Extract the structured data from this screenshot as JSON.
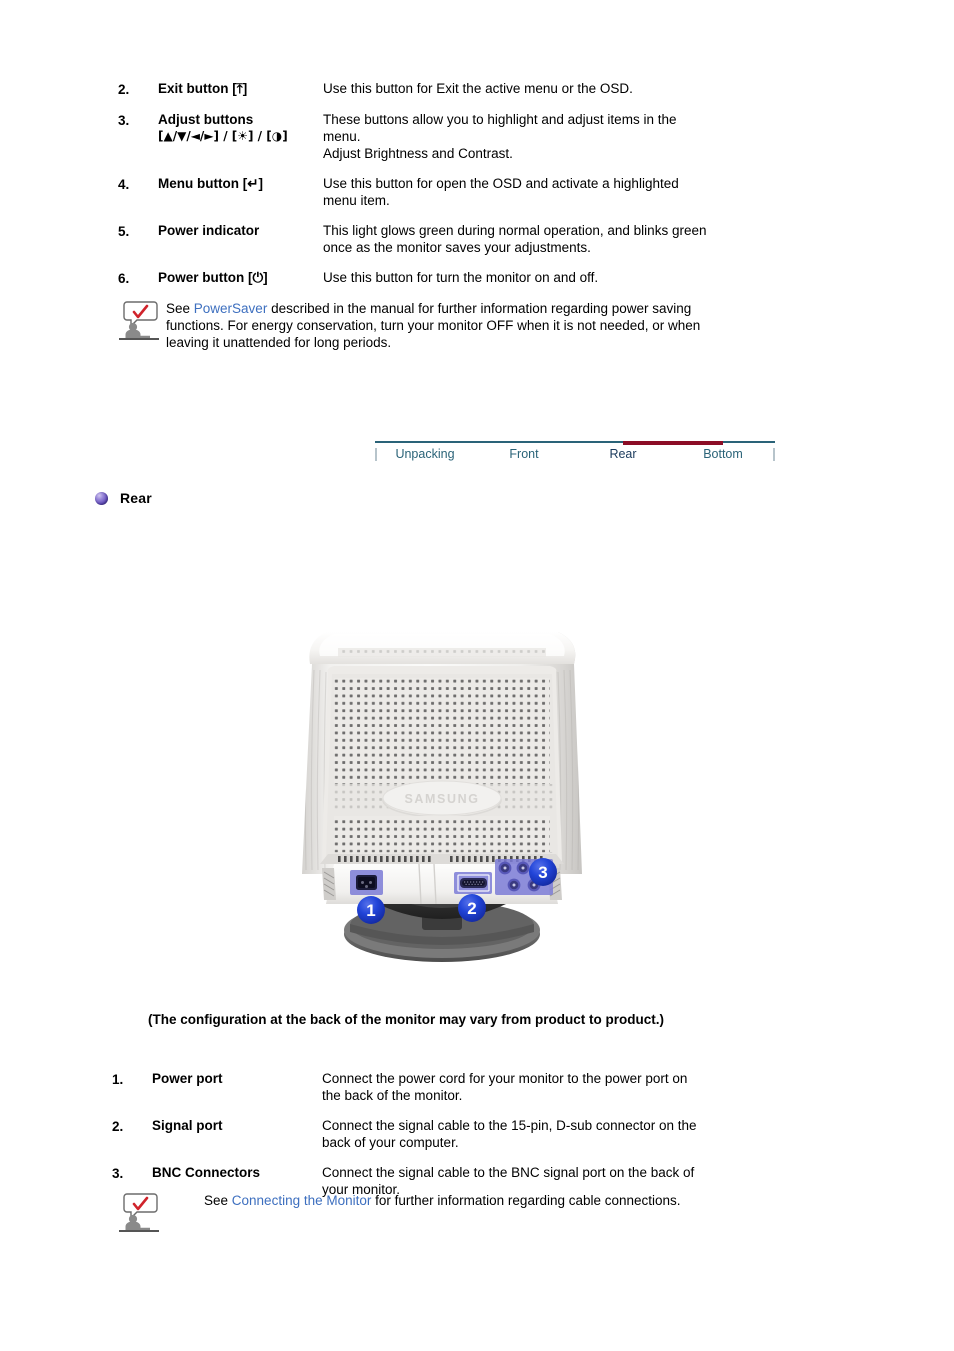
{
  "front_controls": {
    "items": [
      {
        "num": "2.",
        "term": "Exit button [",
        "term_glyph": "⇥⬆",
        "term_tail": "]",
        "term_lines": [
          "Exit button [⤒]"
        ],
        "desc": [
          "Use this button for Exit the active menu or the OSD."
        ]
      },
      {
        "num": "3.",
        "term_lines": [
          "Adjust buttons",
          "[▲/▼/◄/►] / [☀] / [◑]"
        ],
        "desc": [
          "These buttons allow you to highlight and adjust items in the",
          "menu.",
          "Adjust Brightness and Contrast."
        ]
      },
      {
        "num": "4.",
        "term_lines": [
          "Menu button [↵]"
        ],
        "desc": [
          "Use this button for open the OSD and activate a highlighted",
          "menu item."
        ]
      },
      {
        "num": "5.",
        "term_lines": [
          "Power indicator"
        ],
        "desc": [
          "This light glows green during normal operation, and blinks green",
          "once as the monitor saves your adjustments."
        ]
      },
      {
        "num": "6.",
        "term_lines": [
          "Power button [⏻]"
        ],
        "desc": [
          "Use this button for turn the monitor on and off."
        ]
      }
    ]
  },
  "note_powersaver": {
    "icon": "note-person-checkmark-icon",
    "lead": "See ",
    "link": "PowerSaver",
    "lines": [
      " described in the manual for further information regarding power saving",
      "functions. For energy conservation, turn your monitor OFF when it is not needed, or when",
      "leaving it unattended for long periods."
    ]
  },
  "tabbar": {
    "tabs": [
      {
        "label": "Unpacking",
        "active": false
      },
      {
        "label": "Front",
        "active": false
      },
      {
        "label": "Rear",
        "active": true
      },
      {
        "label": "Bottom",
        "active": false
      },
      {
        "label": "",
        "active": false
      }
    ],
    "rule_color": "#2a6378",
    "active_indicator_color": "#8c0d26",
    "tab_color": "#2a6378",
    "active_tab_color": "#1a3a5c"
  },
  "section": {
    "bullet": "purple-sphere-bullet-icon",
    "title": "Rear"
  },
  "figure": {
    "name": "monitor-rear-view-illustration",
    "brand_emboss": "SAMSUNG",
    "callouts": [
      {
        "id": "1",
        "label": "1"
      },
      {
        "id": "2",
        "label": "2"
      },
      {
        "id": "3",
        "label": "3"
      }
    ],
    "badge_color": "#1a3fd4",
    "highlight_color": "#6f6fd8",
    "ports": {
      "power": "power-port",
      "signal": "signal-port-d-sub",
      "bnc": "bnc-connectors"
    }
  },
  "caption": "(The configuration at the back of the monitor may vary from product to product.)",
  "rear_ports": {
    "items": [
      {
        "num": "1.",
        "term_lines": [
          "Power port"
        ],
        "desc": [
          "Connect the power cord for your monitor to the power port on",
          "the back of the monitor."
        ]
      },
      {
        "num": "2.",
        "term_lines": [
          "Signal port"
        ],
        "desc": [
          "Connect the signal cable to the 15-pin, D-sub connector on the",
          "back of your computer."
        ]
      },
      {
        "num": "3.",
        "term_lines": [
          "BNC Connectors"
        ],
        "desc": [
          "Connect the signal cable to the BNC signal port on the back of",
          "your monitor."
        ]
      }
    ]
  },
  "note_connecting": {
    "icon": "note-person-checkmark-icon",
    "lead": "See ",
    "link": "Connecting the Monitor",
    "lines": [
      " for further information regarding cable connections."
    ]
  }
}
